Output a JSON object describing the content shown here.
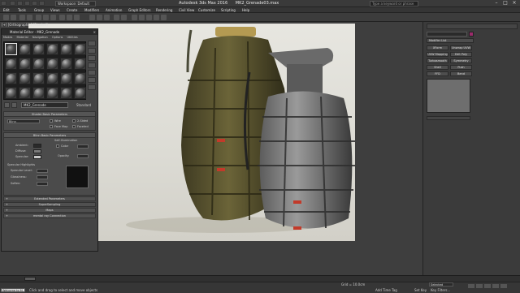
{
  "titlebar": {
    "workspace": "Workspace: Default",
    "app": "Autodesk 3ds Max 2016",
    "file": "MK2_Grenade03.max",
    "search_placeholder": "Type a keyword or phrase"
  },
  "menu": [
    "Edit",
    "Tools",
    "Group",
    "Views",
    "Create",
    "Modifiers",
    "Animation",
    "Graph Editors",
    "Rendering",
    "Civil View",
    "Customize",
    "Scripting",
    "Help"
  ],
  "viewport": {
    "label": "[+] [Orthographic] [Shaded]"
  },
  "material_editor": {
    "title": "Material Editor - MK2_Grenade",
    "menu": [
      "Modes",
      "Material",
      "Navigation",
      "Options",
      "Utilities"
    ],
    "material_name": "MK2_Grenade",
    "material_type": "Standard",
    "shader_basic": {
      "header": "Shader Basic Parameters",
      "shader": "Blinn",
      "wire": "Wire",
      "two_sided": "2-Sided",
      "face_map": "Face Map",
      "faceted": "Faceted"
    },
    "blinn_basic": {
      "header": "Blinn Basic Parameters",
      "self_illum": "Self-Illumination",
      "ambient": "Ambient:",
      "diffuse": "Diffuse:",
      "specular": "Specular:",
      "color": "Color",
      "opacity": "Opacity:",
      "spec_highlights": "Specular Highlights",
      "spec_level": "Specular Level:",
      "glossiness": "Glossiness:",
      "soften": "Soften:"
    },
    "rollouts": [
      "Extended Parameters",
      "SuperSampling",
      "Maps",
      "mental ray Connection"
    ]
  },
  "command_panel": {
    "modifier_list": "Modifier List",
    "buttons": [
      "XForm",
      "Unwrap UVW",
      "UVW Mapping",
      "Edit Poly",
      "Turbosmooth",
      "Symmetry",
      "Shell",
      "Push",
      "FFD",
      "Bend"
    ]
  },
  "status": {
    "prompt": "Click and drag to select and move objects",
    "selected": "Selected",
    "grid": "Grid = 10.0cm",
    "add_time_tag": "Add Time Tag",
    "set_key": "Set Key",
    "key_filters": "Key Filters...",
    "welcome": "Welcome to M"
  },
  "colors": {
    "accent": "#e8e8e8",
    "ambient_swatch": "#2a2a2a",
    "diffuse_swatch": "#7a7a7a",
    "specular_swatch": "#c8c8c8"
  }
}
